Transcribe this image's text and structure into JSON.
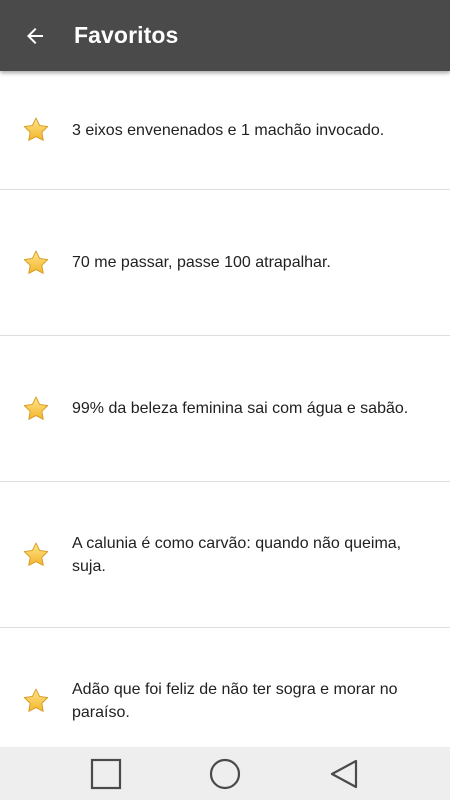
{
  "appbar": {
    "title": "Favoritos",
    "background": "#4a4a4a",
    "back_icon": "arrow-left-icon"
  },
  "favorites": {
    "icon": "star-icon",
    "star_color": "#f6c445",
    "items": [
      {
        "text": "3 eixos envenenados e 1 machão invocado."
      },
      {
        "text": "70 me passar, passe 100 atrapalhar."
      },
      {
        "text": "99% da beleza feminina sai com água e sabão."
      },
      {
        "text": "A calunia é como carvão: quando não queima, suja."
      },
      {
        "text": "Adão que foi feliz de não ter sogra e morar no paraíso."
      }
    ]
  },
  "navbar": {
    "buttons": [
      "recent-apps-icon",
      "home-icon",
      "back-triangle-icon"
    ]
  }
}
